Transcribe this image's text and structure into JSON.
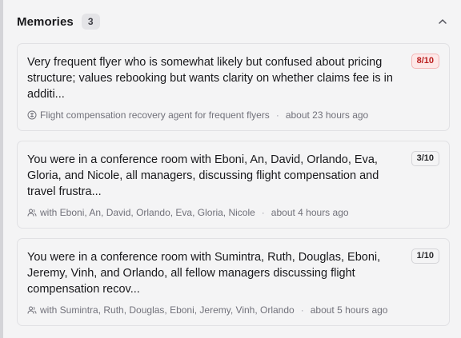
{
  "memories": {
    "title": "Memories",
    "count": "3",
    "items": [
      {
        "text": "Very frequent flyer who is somewhat likely but confused about pricing structure; values rebooking but wants clarity on whether claims fee is in additi...",
        "score": "8/10",
        "context_icon": "agent-icon",
        "context": "Flight compensation recovery agent for frequent flyers",
        "time": "about 23 hours ago"
      },
      {
        "text": "You were in a conference room with Eboni, An, David, Orlando, Eva, Gloria, and Nicole, all managers, discussing flight compensation and travel frustra...",
        "score": "3/10",
        "context_icon": "people-icon",
        "context": "with Eboni, An, David, Orlando, Eva, Gloria, Nicole",
        "time": "about 4 hours ago"
      },
      {
        "text": "You were in a conference room with Sumintra, Ruth, Douglas, Eboni, Jeremy, Vinh, and Orlando, all fellow managers discussing flight compensation recov...",
        "score": "1/10",
        "context_icon": "people-icon",
        "context": "with Sumintra, Ruth, Douglas, Eboni, Jeremy, Vinh, Orlando",
        "time": "about 5 hours ago"
      }
    ]
  },
  "colors": {
    "high_score_bg": "#fde8e8",
    "high_score_text": "#b91c1c"
  }
}
